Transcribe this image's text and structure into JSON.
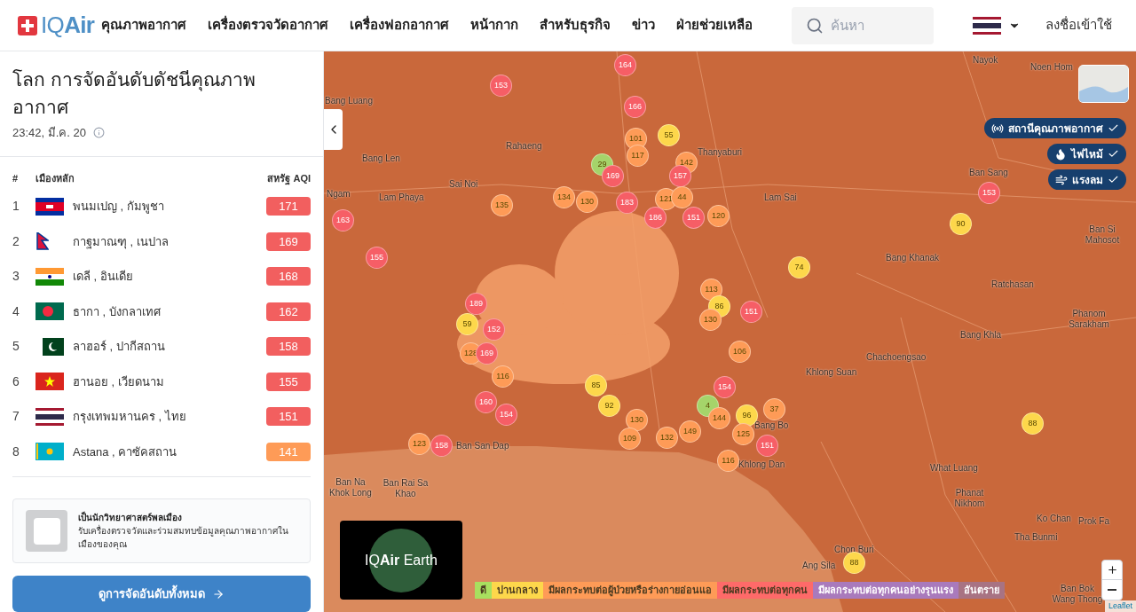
{
  "header": {
    "logo": "IQ**Air**",
    "nav": [
      "คุณภาพอากาศ",
      "เครื่องตรวจวัดอากาศ",
      "เครื่องฟอกอากาศ",
      "หน้ากาก",
      "สำหรับธุรกิจ",
      "ข่าว",
      "ฝ่ายช่วยเหลือ"
    ],
    "search": {
      "placeholder": "ค้นหา"
    },
    "sign_in": "ลงชื่อเข้าใช้"
  },
  "ranking": {
    "title": "โลก การจัดอันดับดัชนีคุณภาพอากาศ",
    "time": "23:42, มี.ค. 20",
    "columns": [
      "#",
      "เมืองหลัก",
      "สหรัฐ AQI"
    ],
    "rows": [
      {
        "rank": "1",
        "kind": "kh",
        "city": "พนมเปญ , กัมพูชา",
        "aqi": "171",
        "color": "#f25f5f"
      },
      {
        "rank": "2",
        "kind": "np",
        "city": "กาฐมาณฑุ , เนปาล",
        "aqi": "169",
        "color": "#f25f5f"
      },
      {
        "rank": "3",
        "kind": "in",
        "city": "เดลี , อินเดีย",
        "aqi": "168",
        "color": "#f25f5f"
      },
      {
        "rank": "4",
        "kind": "bd",
        "city": "ธากา , บังกลาเทศ",
        "aqi": "162",
        "color": "#f25f5f"
      },
      {
        "rank": "5",
        "kind": "pk",
        "city": "ลาฮอร์ , ปากีสถาน",
        "aqi": "158",
        "color": "#f25f5f"
      },
      {
        "rank": "6",
        "kind": "vn",
        "city": "ฮานอย , เวียดนาม",
        "aqi": "155",
        "color": "#f25f5f"
      },
      {
        "rank": "7",
        "kind": "th",
        "city": "กรุงเทพมหานคร , ไทย",
        "aqi": "151",
        "color": "#f25f5f"
      },
      {
        "rank": "8",
        "kind": "kz",
        "city": "Astana , คาซัคสถาน",
        "aqi": "141",
        "color": "#fe9b57"
      }
    ],
    "promo": {
      "title": "เป็นนักวิทยาศาสตร์พลเมือง",
      "body": "รับเครื่องตรวจวัดและร่วมสมทบข้อมูลคุณภาพอากาศในเมืองของคุณ"
    },
    "button": "ดูการจัดอันดับทั้งหมด"
  },
  "map": {
    "layers": [
      {
        "label": "สถานีคุณภาพอากาศ",
        "kind": "station",
        "on": true
      },
      {
        "label": "ไฟไหม้",
        "kind": "fire",
        "on": true
      },
      {
        "label": "แรงลม",
        "kind": "wind",
        "on": true
      }
    ],
    "places": [
      "Nayok",
      "Noen Hom",
      "Bang Luang",
      "Rahaeng",
      "Bang Len",
      "Thanyaburi",
      "Sai Noi",
      "Lam Phaya",
      "Lam Sai",
      "Ban Sang",
      "Ngam",
      "Bang Khanak",
      "Ban Si Mahosot",
      "Ratchasan",
      "Phanom Sarakham",
      "Bang Khla",
      "Chachoengsao",
      "Khlong Suan",
      "Bang Bo",
      "Ban San Dap",
      "Khlong Dan",
      "Ban Na Khok Long",
      "Ban Rai Sa Khao",
      "What Luang",
      "Phanat Nikhom",
      "Ko Chan",
      "Prok Fa",
      "Tha Bunmi",
      "Chon Buri",
      "Ang Sila",
      "Ban Bok Wang Thong"
    ],
    "markers": [
      {
        "value": "164",
        "color": "#f65e66"
      },
      {
        "value": "153",
        "color": "#f65e66"
      },
      {
        "value": "166",
        "color": "#f65e66"
      },
      {
        "value": "101",
        "color": "#fe9b57"
      },
      {
        "value": "55",
        "color": "#fdd74b"
      },
      {
        "value": "117",
        "color": "#fe9b57"
      },
      {
        "value": "142",
        "color": "#fe9b57"
      },
      {
        "value": "29",
        "color": "#a5d46a"
      },
      {
        "value": "169",
        "color": "#f65e66"
      },
      {
        "value": "157",
        "color": "#f65e66"
      },
      {
        "value": "134",
        "color": "#fe9b57"
      },
      {
        "value": "130",
        "color": "#fe9b57"
      },
      {
        "value": "183",
        "color": "#f65e66"
      },
      {
        "value": "121",
        "color": "#fe9b57"
      },
      {
        "value": "44",
        "color": "#fe9b57"
      },
      {
        "value": "135",
        "color": "#fe9b57"
      },
      {
        "value": "186",
        "color": "#f65e66"
      },
      {
        "value": "151",
        "color": "#f65e66"
      },
      {
        "value": "120",
        "color": "#fe9b57"
      },
      {
        "value": "163",
        "color": "#f65e66"
      },
      {
        "value": "153",
        "color": "#f65e66"
      },
      {
        "value": "90",
        "color": "#fdd74b"
      },
      {
        "value": "155",
        "color": "#f65e66"
      },
      {
        "value": "74",
        "color": "#fdd74b"
      },
      {
        "value": "113",
        "color": "#fe9b57"
      },
      {
        "value": "86",
        "color": "#fdd74b"
      },
      {
        "value": "151",
        "color": "#f65e66"
      },
      {
        "value": "130",
        "color": "#fe9b57"
      },
      {
        "value": "189",
        "color": "#f65e66"
      },
      {
        "value": "59",
        "color": "#fdd74b"
      },
      {
        "value": "152",
        "color": "#f65e66"
      },
      {
        "value": "128",
        "color": "#fe9b57"
      },
      {
        "value": "169",
        "color": "#f65e66"
      },
      {
        "value": "106",
        "color": "#fe9b57"
      },
      {
        "value": "116",
        "color": "#fe9b57"
      },
      {
        "value": "154",
        "color": "#f65e66"
      },
      {
        "value": "85",
        "color": "#fdd74b"
      },
      {
        "value": "160",
        "color": "#f65e66"
      },
      {
        "value": "92",
        "color": "#fdd74b"
      },
      {
        "value": "4",
        "color": "#a5d46a"
      },
      {
        "value": "154",
        "color": "#f65e66"
      },
      {
        "value": "130",
        "color": "#fe9b57"
      },
      {
        "value": "144",
        "color": "#fe9b57"
      },
      {
        "value": "96",
        "color": "#fdd74b"
      },
      {
        "value": "37",
        "color": "#fe9b57"
      },
      {
        "value": "123",
        "color": "#fe9b57"
      },
      {
        "value": "158",
        "color": "#f65e66"
      },
      {
        "value": "109",
        "color": "#fe9b57"
      },
      {
        "value": "132",
        "color": "#fe9b57"
      },
      {
        "value": "149",
        "color": "#fe9b57"
      },
      {
        "value": "125",
        "color": "#fe9b57"
      },
      {
        "value": "151",
        "color": "#f65e66"
      },
      {
        "value": "116",
        "color": "#fe9b57"
      },
      {
        "value": "88",
        "color": "#fdd74b"
      },
      {
        "value": "88",
        "color": "#fdd74b"
      }
    ],
    "earth": "IQ**Air** Earth",
    "legend": [
      {
        "label": "ดี",
        "color": "#a8e05f"
      },
      {
        "label": "ปานกลาง",
        "color": "#fdd74b"
      },
      {
        "label": "มีผลกระทบต่อผู้ป่วยหรือร่างกายอ่อนแอ",
        "color": "#fe9b57"
      },
      {
        "label": "มีผลกระทบต่อทุกคน",
        "color": "#fe6a69"
      },
      {
        "label": "มีผลกระทบต่อทุกคนอย่างรุนแรง",
        "color": "#a97abc"
      },
      {
        "label": "อันตราย",
        "color": "#a87383"
      }
    ],
    "attribution": "Leaflet"
  }
}
